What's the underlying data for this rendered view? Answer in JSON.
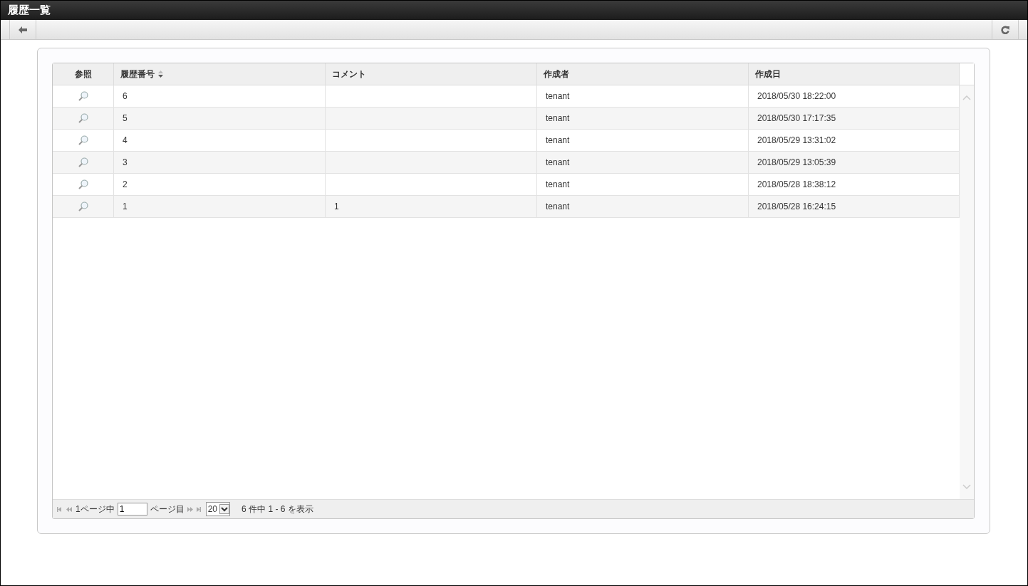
{
  "window": {
    "title": "履歴一覧"
  },
  "table": {
    "columns": [
      {
        "label": "参照",
        "sortable": false
      },
      {
        "label": "履歴番号",
        "sortable": true
      },
      {
        "label": "コメント",
        "sortable": false
      },
      {
        "label": "作成者",
        "sortable": false
      },
      {
        "label": "作成日",
        "sortable": false
      }
    ],
    "rows": [
      {
        "number": "6",
        "comment": "",
        "author": "tenant",
        "created": "2018/05/30 18:22:00"
      },
      {
        "number": "5",
        "comment": "",
        "author": "tenant",
        "created": "2018/05/30 17:17:35"
      },
      {
        "number": "4",
        "comment": "",
        "author": "tenant",
        "created": "2018/05/29 13:31:02"
      },
      {
        "number": "3",
        "comment": "",
        "author": "tenant",
        "created": "2018/05/29 13:05:39"
      },
      {
        "number": "2",
        "comment": "",
        "author": "tenant",
        "created": "2018/05/28 18:38:12"
      },
      {
        "number": "1",
        "comment": "1",
        "author": "tenant",
        "created": "2018/05/28 16:24:15"
      }
    ]
  },
  "pager": {
    "pages_label": "1ページ中",
    "page": "1",
    "page_suffix": "ページ目",
    "page_size": "20",
    "summary": "6 件中 1 - 6 を表示"
  }
}
